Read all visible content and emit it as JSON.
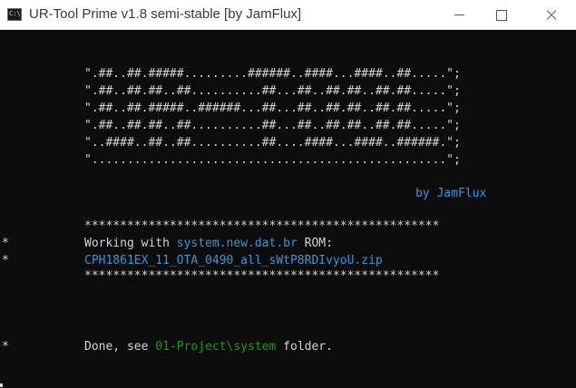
{
  "window": {
    "title": "UR-Tool Prime v1.8 semi-stable [by JamFlux]",
    "icon_text": "C:\\."
  },
  "console": {
    "banner": [
      "\".##..##.#####.........######..####...####..##.....\";",
      "\".##..##.##..##..........##...##..##.##..##.##.....\";",
      "\".##..##.#####..######...##...##..##.##..##.##.....\";",
      "\".##..##.##..##..........##...##..##.##..##.##.....\";",
      "\"..####..##..##..........##....####...####..######.\";",
      "\"..................................................\";"
    ],
    "author": "by JamFlux",
    "separator": "**************************************************",
    "marker": "*",
    "working_prefix": "Working with ",
    "working_file": "system.new.dat.br",
    "working_suffix": " ROM:",
    "rom_name": "CPH1861EX_11_OTA_0490_all_sWtP8RDIvyoU.zip",
    "done_prefix": "Done, see ",
    "done_path": "01-Project\\system",
    "done_suffix": " folder."
  },
  "colors": {
    "background": "#0c0c0c",
    "text": "#d4d4d4",
    "cyan": "#3a96dd",
    "green": "#13a10e"
  }
}
